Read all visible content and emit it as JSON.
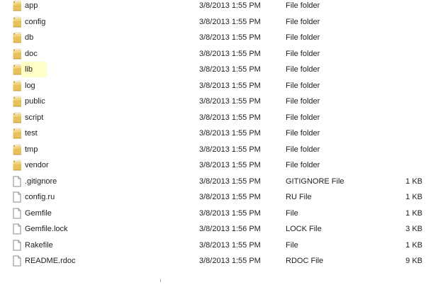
{
  "files": [
    {
      "name": "app",
      "date": "3/8/2013 1:55 PM",
      "type": "File folder",
      "size": "",
      "icon": "folder-icon"
    },
    {
      "name": "config",
      "date": "3/8/2013 1:55 PM",
      "type": "File folder",
      "size": "",
      "icon": "folder-icon"
    },
    {
      "name": "db",
      "date": "3/8/2013 1:55 PM",
      "type": "File folder",
      "size": "",
      "icon": "folder-icon"
    },
    {
      "name": "doc",
      "date": "3/8/2013 1:55 PM",
      "type": "File folder",
      "size": "",
      "icon": "folder-icon"
    },
    {
      "name": "lib",
      "date": "3/8/2013 1:55 PM",
      "type": "File folder",
      "size": "",
      "icon": "folder-icon",
      "highlighted": true
    },
    {
      "name": "log",
      "date": "3/8/2013 1:55 PM",
      "type": "File folder",
      "size": "",
      "icon": "folder-icon"
    },
    {
      "name": "public",
      "date": "3/8/2013 1:55 PM",
      "type": "File folder",
      "size": "",
      "icon": "folder-icon"
    },
    {
      "name": "script",
      "date": "3/8/2013 1:55 PM",
      "type": "File folder",
      "size": "",
      "icon": "folder-icon"
    },
    {
      "name": "test",
      "date": "3/8/2013 1:55 PM",
      "type": "File folder",
      "size": "",
      "icon": "folder-icon"
    },
    {
      "name": "tmp",
      "date": "3/8/2013 1:55 PM",
      "type": "File folder",
      "size": "",
      "icon": "folder-icon"
    },
    {
      "name": "vendor",
      "date": "3/8/2013 1:55 PM",
      "type": "File folder",
      "size": "",
      "icon": "folder-icon"
    },
    {
      "name": ".gitignore",
      "date": "3/8/2013 1:55 PM",
      "type": "GITIGNORE File",
      "size": "1 KB",
      "icon": "file-icon"
    },
    {
      "name": "config.ru",
      "date": "3/8/2013 1:55 PM",
      "type": "RU File",
      "size": "1 KB",
      "icon": "file-icon"
    },
    {
      "name": "Gemfile",
      "date": "3/8/2013 1:55 PM",
      "type": "File",
      "size": "1 KB",
      "icon": "file-icon"
    },
    {
      "name": "Gemfile.lock",
      "date": "3/8/2013 1:56 PM",
      "type": "LOCK File",
      "size": "3 KB",
      "icon": "file-icon"
    },
    {
      "name": "Rakefile",
      "date": "3/8/2013 1:55 PM",
      "type": "File",
      "size": "1 KB",
      "icon": "file-icon"
    },
    {
      "name": "README.rdoc",
      "date": "3/8/2013 1:55 PM",
      "type": "RDOC File",
      "size": "9 KB",
      "icon": "file-icon"
    }
  ],
  "colors": {
    "highlight": "#ffffc8",
    "folder": "#e8c15a",
    "text": "#1e1e1e"
  }
}
